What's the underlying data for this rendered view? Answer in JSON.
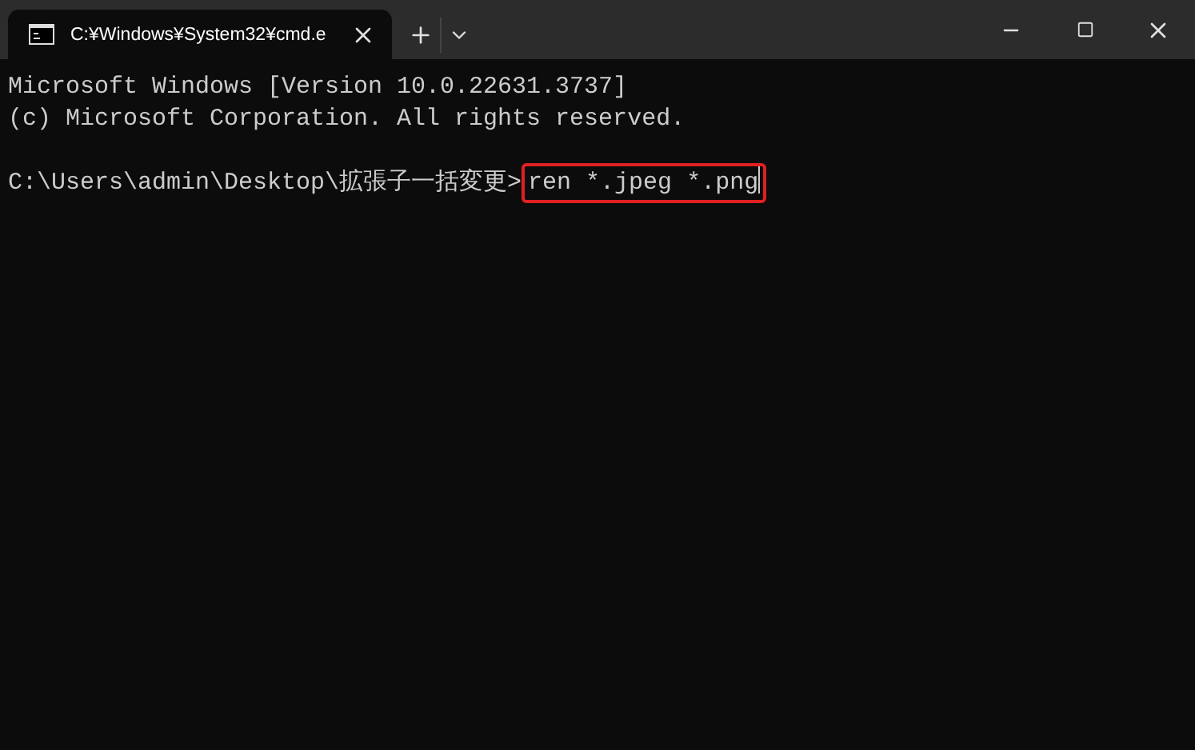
{
  "window": {
    "tab_title": "C:¥Windows¥System32¥cmd.e"
  },
  "console": {
    "lines": [
      {
        "kind": "text",
        "text": "Microsoft Windows [Version 10.0.22631.3737]"
      },
      {
        "kind": "text",
        "text": "(c) Microsoft Corporation. All rights reserved."
      },
      {
        "kind": "blank"
      },
      {
        "kind": "prompt",
        "prompt": "C:\\Users\\admin\\Desktop\\拡張子一括変更>",
        "command": "ren *.jpeg *.png",
        "highlighted": true
      }
    ]
  }
}
